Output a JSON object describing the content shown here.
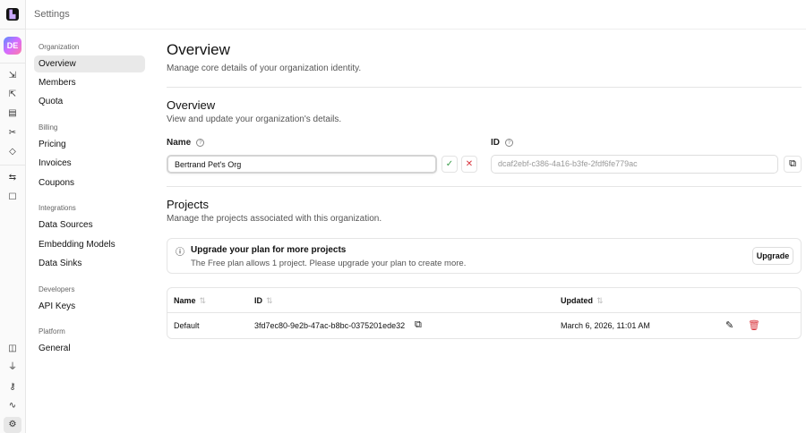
{
  "header": {
    "title": "Settings"
  },
  "rail": {
    "avatar": "DE",
    "icons": [
      "import-icon",
      "export-icon",
      "document-icon",
      "scissors-icon",
      "tags-icon",
      "workflow-icon",
      "bot-icon",
      "book-icon",
      "plug-icon",
      "key-icon",
      "activity-icon",
      "settings-icon"
    ]
  },
  "nav": {
    "groups": [
      {
        "label": "Organization",
        "items": [
          "Overview",
          "Members",
          "Quota"
        ]
      },
      {
        "label": "Billing",
        "items": [
          "Pricing",
          "Invoices",
          "Coupons"
        ]
      },
      {
        "label": "Integrations",
        "items": [
          "Data Sources",
          "Embedding Models",
          "Data Sinks"
        ]
      },
      {
        "label": "Developers",
        "items": [
          "API Keys"
        ]
      },
      {
        "label": "Platform",
        "items": [
          "General"
        ]
      }
    ]
  },
  "page": {
    "title": "Overview",
    "subtitle": "Manage core details of your organization identity."
  },
  "overview": {
    "title": "Overview",
    "subtitle": "View and update your organization's details.",
    "name_label": "Name",
    "name_value": "Bertrand Pet's Org",
    "id_label": "ID",
    "id_value": "dcaf2ebf-c386-4a16-b3fe-2fdf6fe779ac",
    "help": "?",
    "confirm": "✓",
    "cancel": "✕"
  },
  "projects": {
    "title": "Projects",
    "subtitle": "Manage the projects associated with this organization.",
    "banner": {
      "title": "Upgrade your plan for more projects",
      "text": "The Free plan allows 1 project. Please upgrade your plan to create more.",
      "button": "Upgrade"
    },
    "columns": [
      "Name",
      "ID",
      "Updated"
    ],
    "rows": [
      {
        "name": "Default",
        "id": "3fd7ec80-9e2b-47ac-b8bc-0375201ede32",
        "updated": "March 6, 2026, 11:01 AM"
      }
    ]
  },
  "colors": {
    "accent_green": "#3a9d4a",
    "danger": "#d9363e"
  }
}
